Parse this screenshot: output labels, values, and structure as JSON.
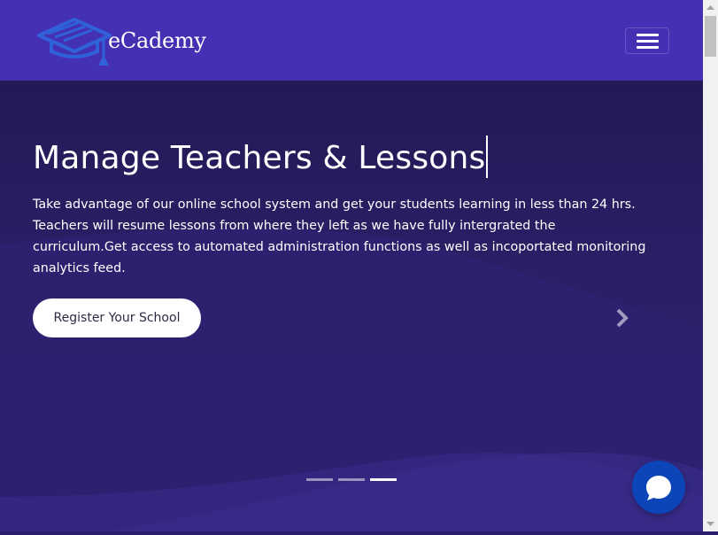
{
  "navbar": {
    "logo_text": "eCademy",
    "logo_icon": "graduation-cap-icon",
    "menu_icon": "hamburger-menu-icon",
    "background": "#4330b3"
  },
  "hero": {
    "title": "Manage Teachers & Lessons",
    "description": "Take advantage of our online school system and get your students learning in less than 24 hrs. Teachers will resume lessons from where they left as we have fully intergrated the curriculum.Get access to automated administration functions as well as incoportated monitoring analytics feed.",
    "cta_label": "Register Your School",
    "next_icon": "chevron-right-icon",
    "slides_count": 3,
    "active_slide": 3
  },
  "chat": {
    "icon": "chat-bubble-icon",
    "color": "#0b45b8"
  },
  "colors": {
    "hero_dark": "#221a55",
    "hero_light": "#2f2377",
    "logo_blue": "#2f62d8"
  }
}
